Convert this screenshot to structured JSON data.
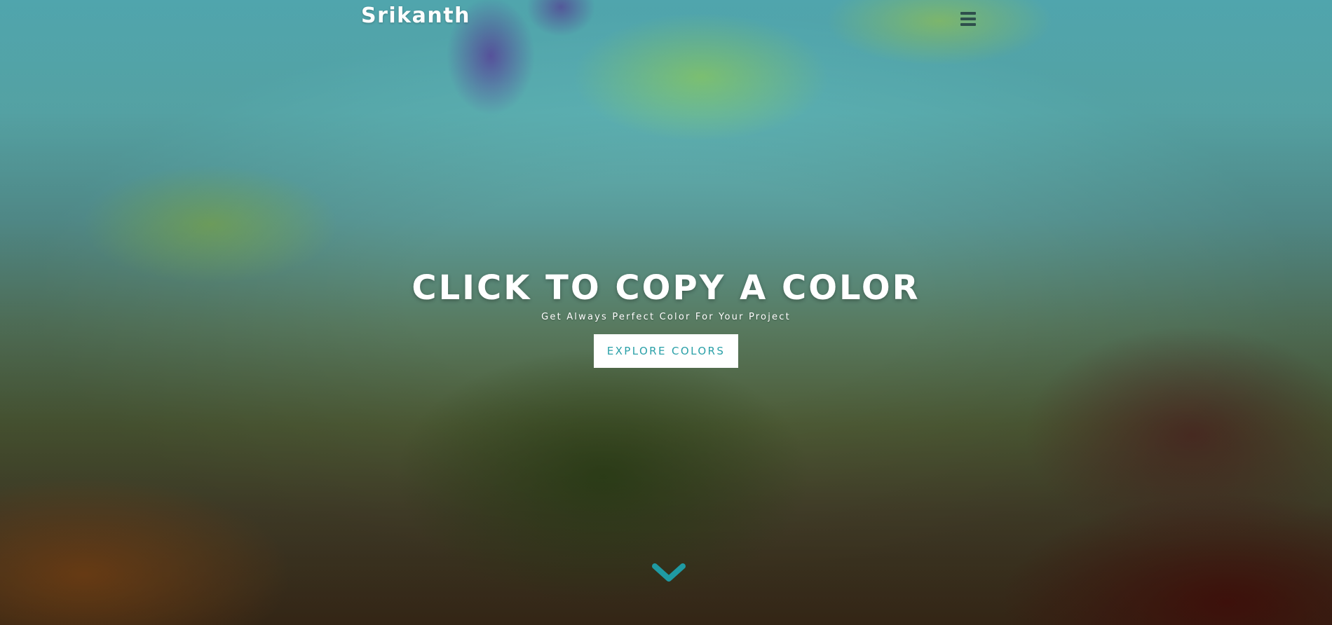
{
  "header": {
    "brand": "Srikanth",
    "menu_icon": "hamburger-menu-icon"
  },
  "hero": {
    "title": "CLICK TO COPY A COLOR",
    "subtitle": "Get Always Perfect Color For Your Project",
    "button_label": "EXPLORE COLORS",
    "scroll_icon": "chevron-down-icon"
  },
  "colors": {
    "accent": "#2aa0a8",
    "menu_icon": "#2e4f4c",
    "text": "#ffffff"
  }
}
